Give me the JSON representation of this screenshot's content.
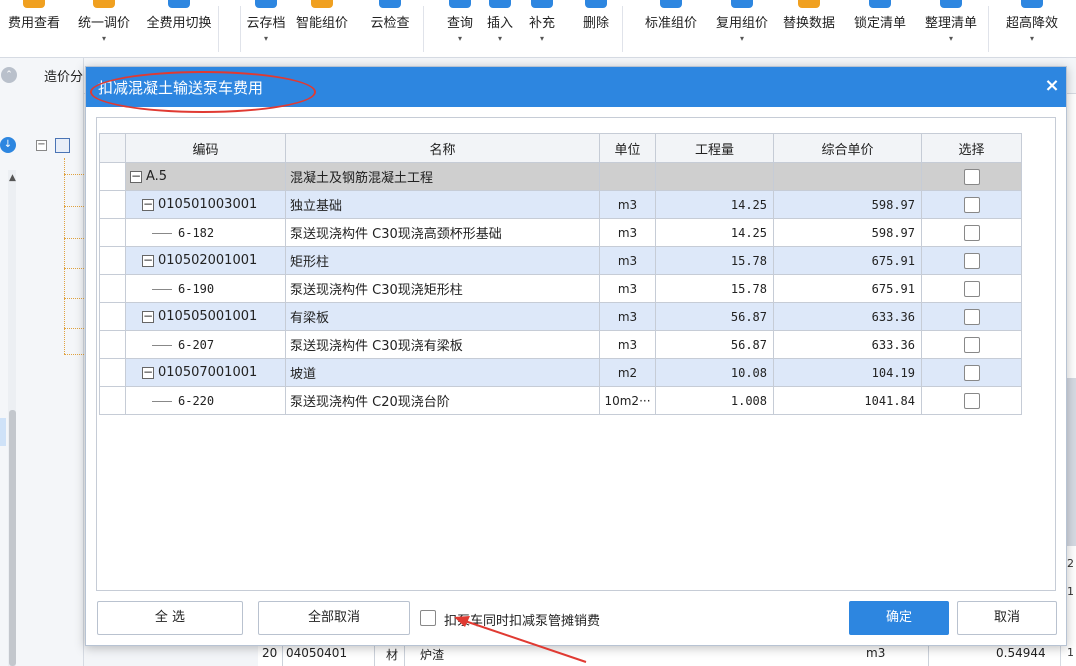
{
  "toolbar": {
    "items": [
      {
        "label": "费用查看",
        "arrow": "",
        "color": "#f0a020"
      },
      {
        "label": "统一调价",
        "arrow": "▾",
        "color": "#f0a020"
      },
      {
        "label": "全费用切换",
        "arrow": "",
        "color": "#2d86e0"
      },
      {
        "label": "云存档",
        "arrow": "▾",
        "color": "#2d86e0"
      },
      {
        "label": "智能组价",
        "arrow": "",
        "color": "#f0a020"
      },
      {
        "label": "云检查",
        "arrow": "",
        "color": "#2d86e0"
      },
      {
        "label": "查询",
        "arrow": "▾",
        "color": "#2d86e0"
      },
      {
        "label": "插入",
        "arrow": "▾",
        "color": "#2d86e0"
      },
      {
        "label": "补充",
        "arrow": "▾",
        "color": "#2d86e0"
      },
      {
        "label": "删除",
        "arrow": "",
        "color": "#2d86e0"
      },
      {
        "label": "标准组价",
        "arrow": "",
        "color": "#2d86e0"
      },
      {
        "label": "复用组价",
        "arrow": "▾",
        "color": "#2d86e0"
      },
      {
        "label": "替换数据",
        "arrow": "",
        "color": "#f0a020"
      },
      {
        "label": "锁定清单",
        "arrow": "",
        "color": "#2d86e0"
      },
      {
        "label": "整理清单",
        "arrow": "▾",
        "color": "#2d86e0"
      },
      {
        "label": "超高降效",
        "arrow": "▾",
        "color": "#2d86e0"
      }
    ]
  },
  "background": {
    "tab_label": "造价分",
    "right_numbers": [
      "2",
      "1",
      "1"
    ],
    "bottom_row": {
      "index": "20",
      "code": "04050401",
      "type": "材",
      "name": "炉渣",
      "unit": "m3",
      "value": "0.54944"
    }
  },
  "dialog": {
    "title": "扣减混凝土输送泵车费用",
    "close_glyph": "×",
    "columns": [
      "编码",
      "名称",
      "单位",
      "工程量",
      "综合单价",
      "选择"
    ],
    "rows": [
      {
        "level": 0,
        "code": "A.5",
        "name": "混凝土及钢筋混凝土工程",
        "unit": "",
        "qty": "",
        "price": "",
        "checked": false
      },
      {
        "level": 1,
        "code": "010501003001",
        "name": "独立基础",
        "unit": "m3",
        "qty": "14.25",
        "price": "598.97",
        "checked": false
      },
      {
        "level": 2,
        "code": "6-182",
        "name": "泵送现浇构件  C30现浇高颈杯形基础",
        "unit": "m3",
        "qty": "14.25",
        "price": "598.97",
        "checked": false
      },
      {
        "level": 1,
        "code": "010502001001",
        "name": "矩形柱",
        "unit": "m3",
        "qty": "15.78",
        "price": "675.91",
        "checked": false
      },
      {
        "level": 2,
        "code": "6-190",
        "name": "泵送现浇构件  C30现浇矩形柱",
        "unit": "m3",
        "qty": "15.78",
        "price": "675.91",
        "checked": false
      },
      {
        "level": 1,
        "code": "010505001001",
        "name": "有梁板",
        "unit": "m3",
        "qty": "56.87",
        "price": "633.36",
        "checked": false
      },
      {
        "level": 2,
        "code": "6-207",
        "name": "泵送现浇构件  C30现浇有梁板",
        "unit": "m3",
        "qty": "56.87",
        "price": "633.36",
        "checked": false
      },
      {
        "level": 1,
        "code": "010507001001",
        "name": "坡道",
        "unit": "m2",
        "qty": "10.08",
        "price": "104.19",
        "checked": false
      },
      {
        "level": 2,
        "code": "6-220",
        "name": "泵送现浇构件  C20现浇台阶",
        "unit": "10m2···",
        "qty": "1.008",
        "price": "1041.84",
        "checked": false
      }
    ],
    "buttons": {
      "select_all": "全 选",
      "deselect_all": "全部取消",
      "confirm": "确定",
      "cancel": "取消"
    },
    "option": {
      "label": "扣泵车同时扣减泵管摊销费",
      "checked": false
    }
  },
  "colors": {
    "accent": "#2d86e0",
    "annotation": "#e03a32",
    "parent_row": "#dde8f9",
    "group_row": "#cfcfcf"
  }
}
